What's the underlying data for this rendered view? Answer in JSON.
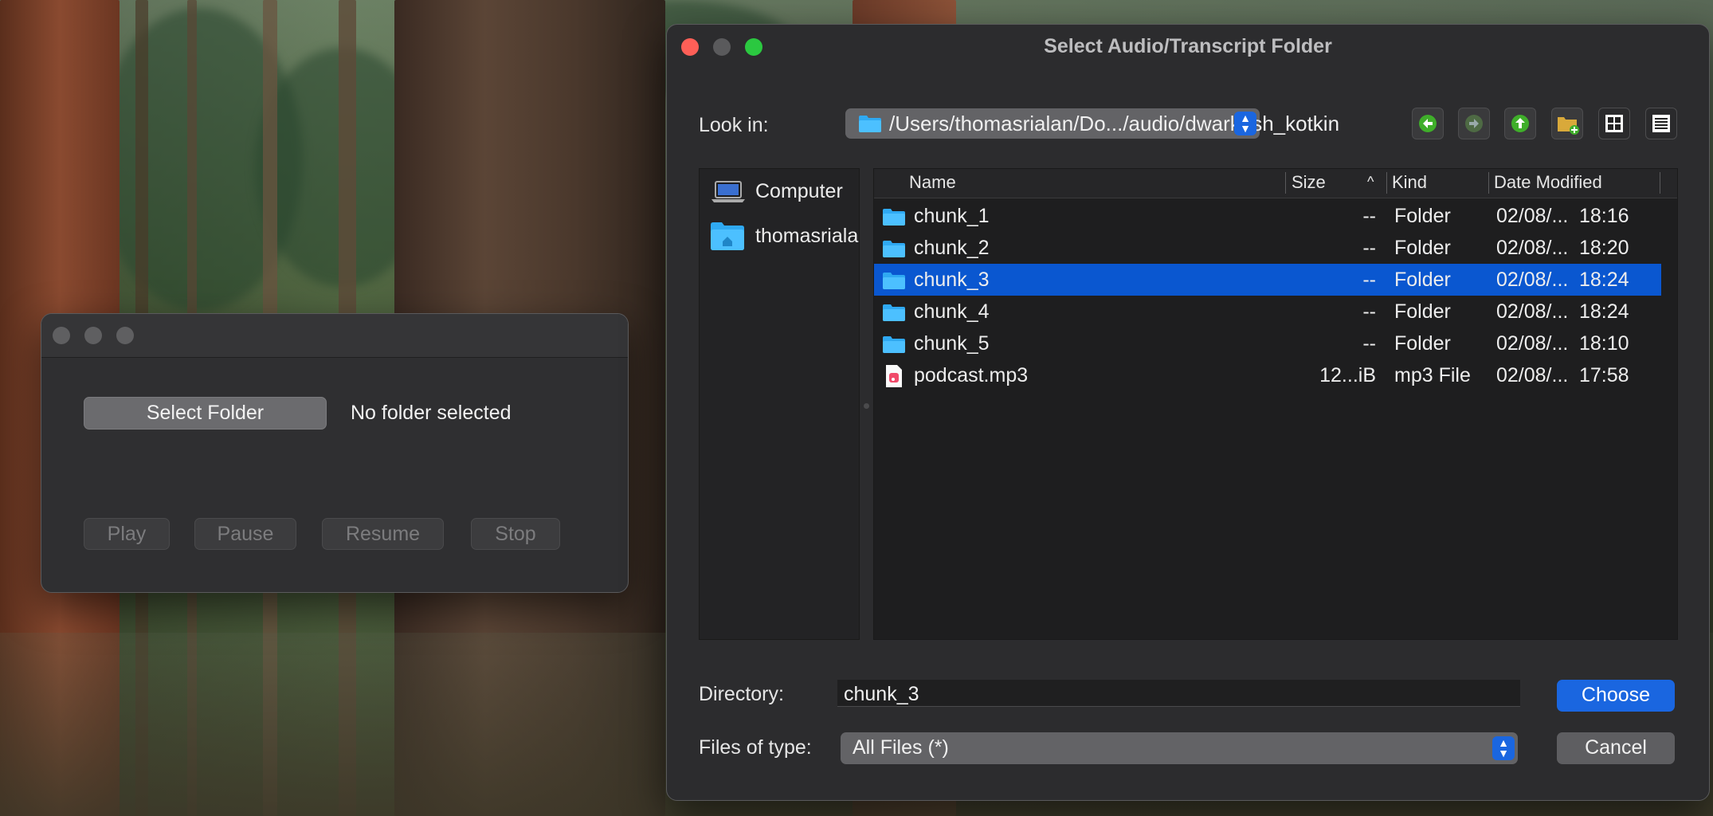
{
  "main_window": {
    "select_folder_label": "Select Folder",
    "status_text": "No folder selected",
    "play_label": "Play",
    "pause_label": "Pause",
    "resume_label": "Resume",
    "stop_label": "Stop"
  },
  "dialog": {
    "title": "Select Audio/Transcript Folder",
    "look_in_label": "Look in:",
    "path": "/Users/thomasrialan/Do.../audio/dwarkesh_kotkin",
    "nav_icons": [
      "back-arrow-icon",
      "forward-arrow-icon",
      "up-arrow-icon",
      "new-folder-icon",
      "icon-view-icon",
      "list-view-icon"
    ],
    "sidebar": [
      {
        "label": "Computer",
        "icon": "computer-icon"
      },
      {
        "label": "thomasrialan",
        "icon": "home-folder-icon"
      }
    ],
    "columns": {
      "name": "Name",
      "size": "Size",
      "sort_indicator": "^",
      "kind": "Kind",
      "date": "Date Modified"
    },
    "files": [
      {
        "name": "chunk_1",
        "size": "--",
        "kind": "Folder",
        "date": "02/08/...",
        "time": "18:16",
        "icon": "folder-icon",
        "selected": false
      },
      {
        "name": "chunk_2",
        "size": "--",
        "kind": "Folder",
        "date": "02/08/...",
        "time": "18:20",
        "icon": "folder-icon",
        "selected": false
      },
      {
        "name": "chunk_3",
        "size": "--",
        "kind": "Folder",
        "date": "02/08/...",
        "time": "18:24",
        "icon": "folder-icon",
        "selected": true
      },
      {
        "name": "chunk_4",
        "size": "--",
        "kind": "Folder",
        "date": "02/08/...",
        "time": "18:24",
        "icon": "folder-icon",
        "selected": false
      },
      {
        "name": "chunk_5",
        "size": "--",
        "kind": "Folder",
        "date": "02/08/...",
        "time": "18:10",
        "icon": "folder-icon",
        "selected": false
      },
      {
        "name": "podcast.mp3",
        "size": "12...iB",
        "kind": "mp3 File",
        "date": "02/08/...",
        "time": "17:58",
        "icon": "audio-file-icon",
        "selected": false
      }
    ],
    "directory_label": "Directory:",
    "directory_value": "chunk_3",
    "files_of_type_label": "Files of type:",
    "files_of_type_value": "All Files (*)",
    "choose_label": "Choose",
    "cancel_label": "Cancel"
  },
  "colors": {
    "selection": "#0a57d0",
    "accent_button": "#1a66e0",
    "close": "#fe5f57",
    "minimize": "#5a5a5c",
    "zoom": "#2bc840",
    "folder": "#2fa9f2"
  }
}
